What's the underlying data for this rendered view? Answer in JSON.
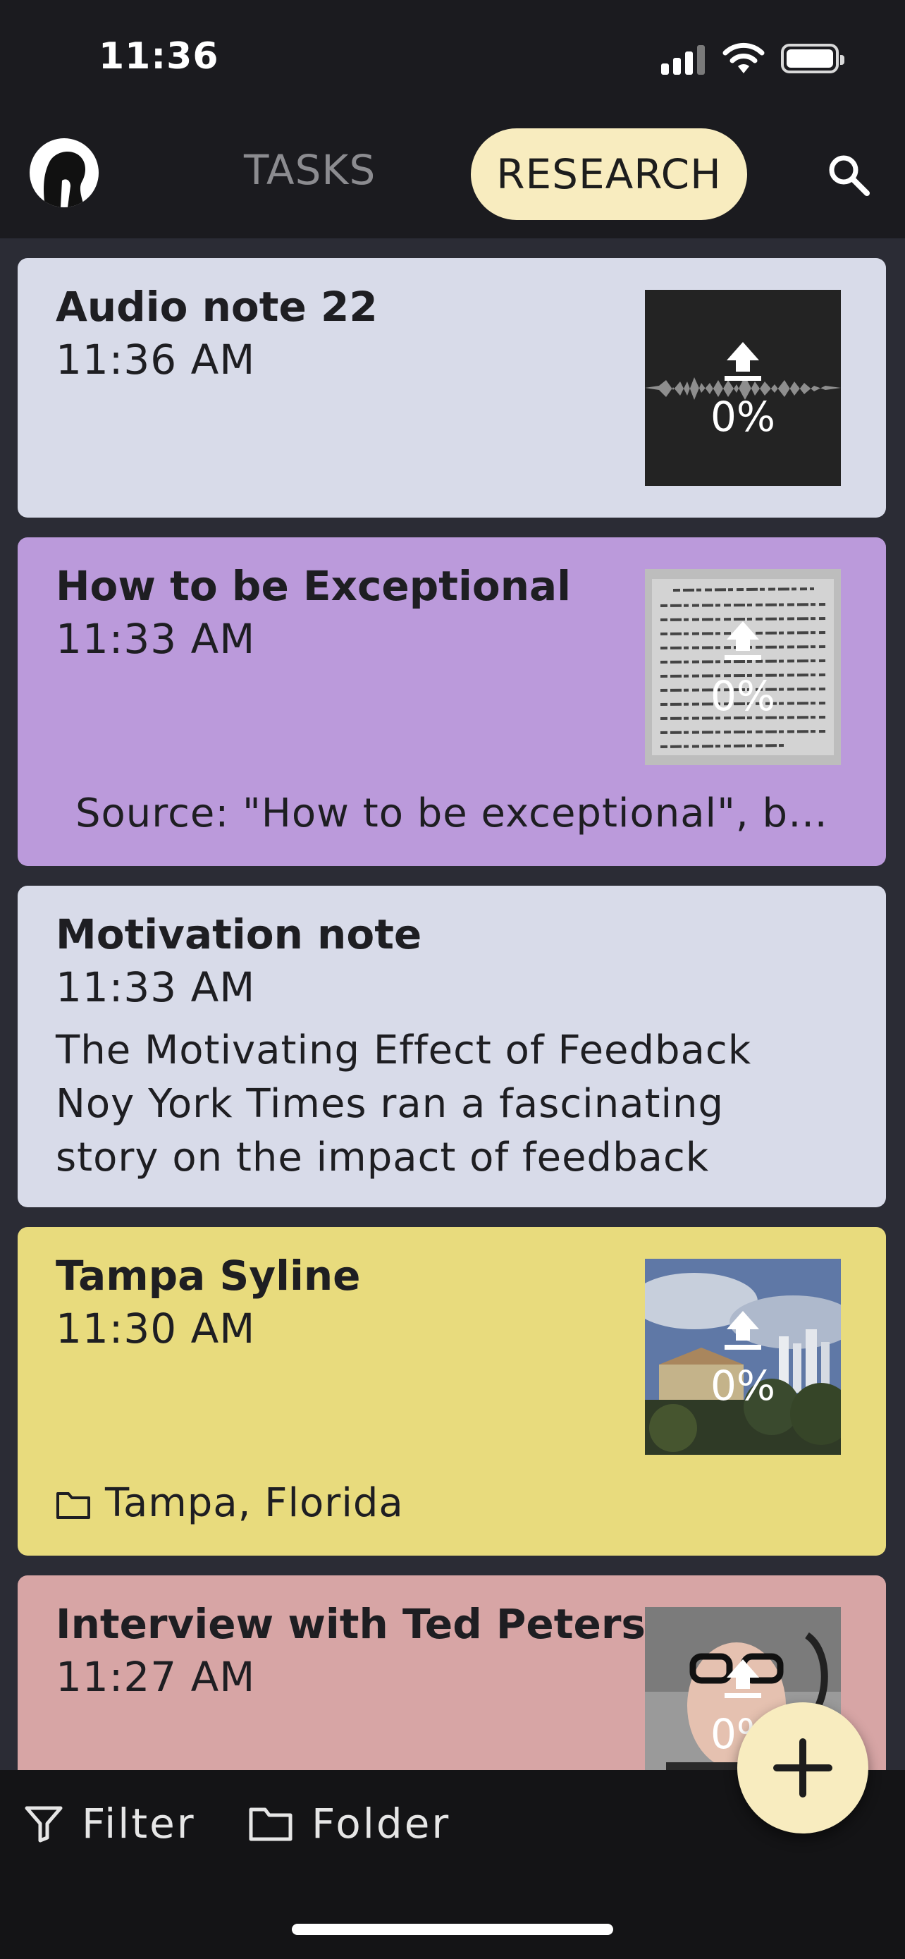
{
  "status_bar": {
    "time": "11:36"
  },
  "header": {
    "tabs": [
      {
        "label": "TASKS",
        "active": false
      },
      {
        "label": "RESEARCH",
        "active": true
      }
    ],
    "icons": {
      "avatar": "profile-avatar",
      "search": "search-icon"
    },
    "accent_color": "#f8ecbf"
  },
  "notes": [
    {
      "title": "Audio note 22",
      "time": "11:36 AM",
      "upload_progress": "0%",
      "color": "#d8dbe9",
      "thumbnail": "audio-waveform"
    },
    {
      "title": "How to be Exceptional",
      "time": "11:33 AM",
      "upload_progress": "0%",
      "color": "#bb9adb",
      "thumbnail": "document-page",
      "source": "Source: \"How to be exceptional\", b…"
    },
    {
      "title": "Motivation note",
      "time": "11:33 AM",
      "color": "#d8dbe9",
      "body_lines": [
        "The Motivating Effect of Feedback",
        "Noy York Times ran a fascinating",
        "story on the impact of feedback"
      ]
    },
    {
      "title": "Tampa Syline",
      "time": "11:30 AM",
      "upload_progress": "0%",
      "color": "#e8db7d",
      "thumbnail": "city-skyline-photo",
      "folder": "Tampa, Florida"
    },
    {
      "title": "Interview with Ted Peters",
      "time": "11:27 AM",
      "upload_progress": "0%",
      "color": "#d7a5a5",
      "thumbnail": "person-photo"
    }
  ],
  "bottom_bar": {
    "filter_label": "Filter",
    "folder_label": "Folder"
  },
  "fab": {
    "icon": "plus-icon"
  }
}
